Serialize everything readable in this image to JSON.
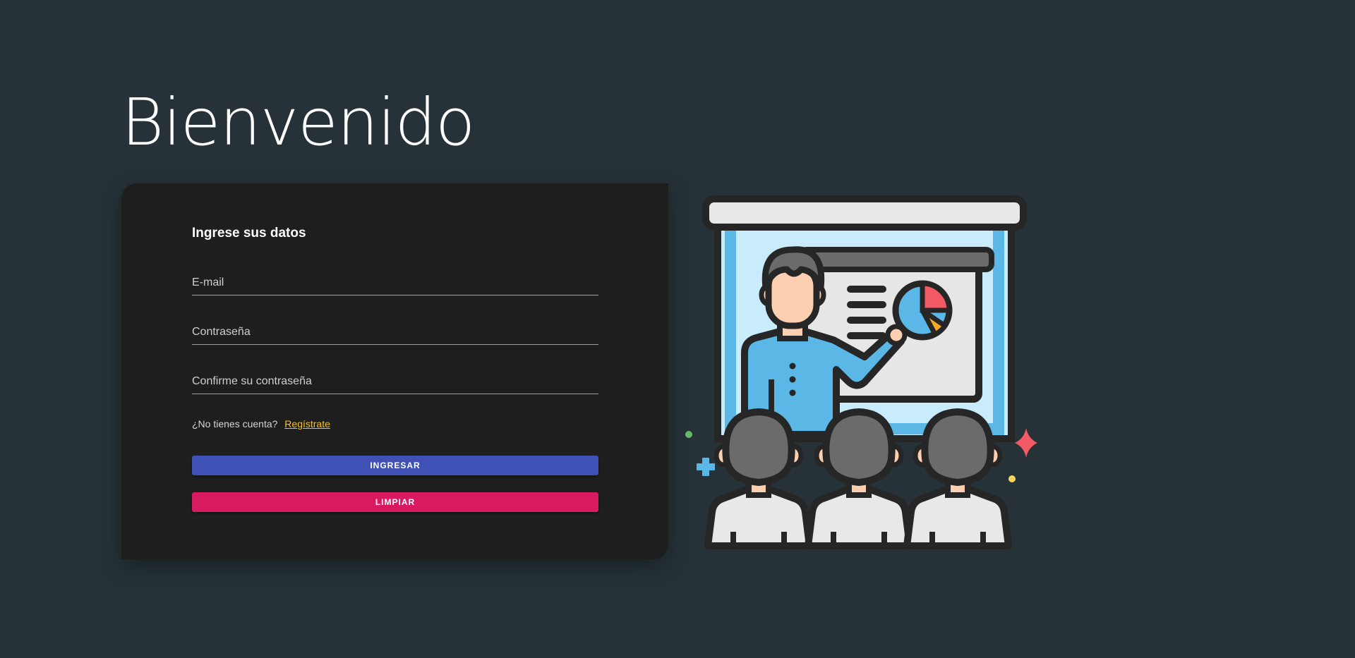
{
  "header": {
    "title": "Bienvenido"
  },
  "form": {
    "title": "Ingrese sus datos",
    "email_placeholder": "E-mail",
    "password_placeholder": "Contraseña",
    "confirm_placeholder": "Confirme su contraseña",
    "no_account_text": "¿No tienes cuenta?",
    "register_link": "Regístrate",
    "submit_label": "INGRESAR",
    "clear_label": "LIMPIAR"
  },
  "colors": {
    "background": "#263238",
    "card": "#1e1e1e",
    "primary": "#3f51b5",
    "secondary": "#d81b60",
    "link": "#ffc107"
  },
  "illustration": {
    "icon": "presentation-audience-icon"
  }
}
